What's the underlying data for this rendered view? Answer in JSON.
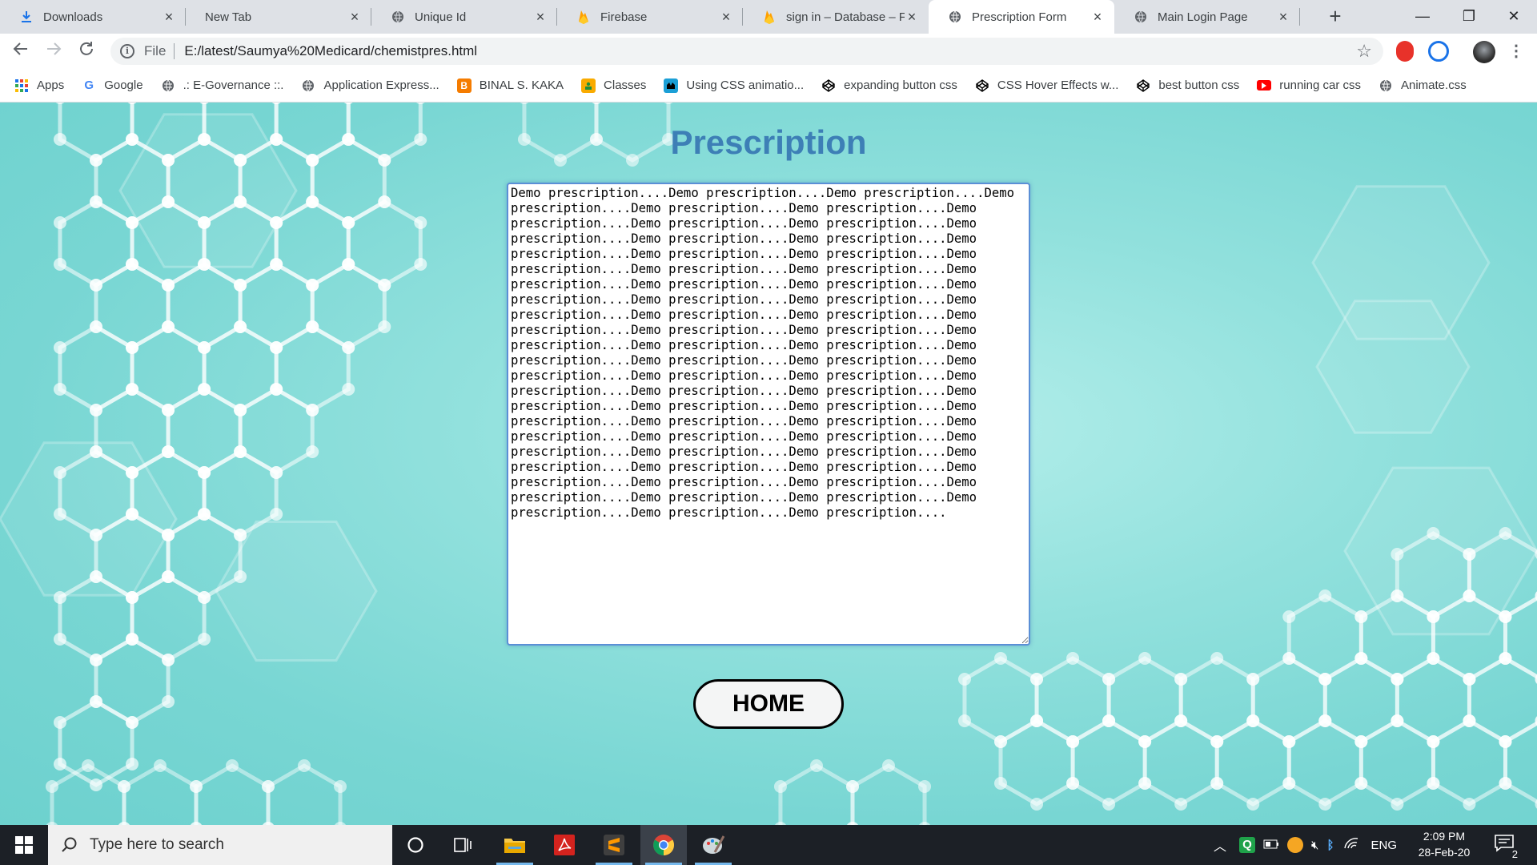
{
  "browser": {
    "tabs": [
      {
        "title": "Downloads",
        "icon": "download-icon",
        "active": false
      },
      {
        "title": "New Tab",
        "icon": "none",
        "active": false
      },
      {
        "title": "Unique Id",
        "icon": "globe-icon",
        "active": false
      },
      {
        "title": "Firebase",
        "icon": "firebase-icon",
        "active": false
      },
      {
        "title": "sign in – Database – Fir",
        "icon": "firebase-icon",
        "active": false
      },
      {
        "title": "Prescription Form",
        "icon": "globe-icon",
        "active": true
      },
      {
        "title": "Main Login Page",
        "icon": "globe-icon",
        "active": false
      }
    ],
    "new_tab_label": "+",
    "window_controls": {
      "minimize": "—",
      "restore": "❐",
      "close": "✕"
    },
    "address": {
      "scheme_label": "File",
      "url": "E:/latest/Saumya%20Medicard/chemistpres.html"
    },
    "bookmarks": [
      {
        "label": "Apps",
        "icon": "apps-grid-icon"
      },
      {
        "label": "Google",
        "icon": "google-icon"
      },
      {
        "label": ".: E-Governance ::.",
        "icon": "globe-icon"
      },
      {
        "label": "Application Express...",
        "icon": "globe-icon"
      },
      {
        "label": "BINAL S. KAKA",
        "icon": "blogger-icon"
      },
      {
        "label": "Classes",
        "icon": "classroom-icon"
      },
      {
        "label": "Using CSS animatio...",
        "icon": "mdn-icon"
      },
      {
        "label": "expanding button css",
        "icon": "codepen-icon"
      },
      {
        "label": "CSS Hover Effects w...",
        "icon": "codepen-icon"
      },
      {
        "label": "best button css",
        "icon": "codepen-icon"
      },
      {
        "label": "running car css",
        "icon": "youtube-icon"
      },
      {
        "label": "Animate.css",
        "icon": "globe-icon"
      }
    ]
  },
  "page": {
    "title": "Prescription",
    "prescription_text": "Demo prescription....Demo prescription....Demo prescription....Demo prescription....Demo prescription....Demo prescription....Demo prescription....Demo prescription....Demo prescription....Demo prescription....Demo prescription....Demo prescription....Demo prescription....Demo prescription....Demo prescription....Demo prescription....Demo prescription....Demo prescription....Demo prescription....Demo prescription....Demo prescription....Demo prescription....Demo prescription....Demo prescription....Demo prescription....Demo prescription....Demo prescription....Demo prescription....Demo prescription....Demo prescription....Demo prescription....Demo prescription....Demo prescription....Demo prescription....Demo prescription....Demo prescription....Demo prescription....Demo prescription....Demo prescription....Demo prescription....Demo prescription....Demo prescription....Demo prescription....Demo prescription....Demo prescription....Demo prescription....Demo prescription....Demo prescription....Demo prescription....Demo prescription....Demo prescription....Demo prescription....Demo prescription....Demo prescription....Demo prescription....Demo prescription....Demo prescription....Demo prescription....Demo prescription....Demo prescription....Demo prescription....Demo prescription....Demo prescription....Demo prescription....Demo prescription....Demo prescription....",
    "home_button": "HOME",
    "colors": {
      "title": "#3d7fb6",
      "background": "#8fe0dc"
    }
  },
  "taskbar": {
    "search_placeholder": "Type here to search",
    "pinned": [
      "cortana-icon",
      "task-view-icon",
      "file-explorer-icon",
      "acrobat-icon",
      "sublime-text-icon",
      "chrome-icon",
      "paint-icon"
    ],
    "tray_language": "ENG",
    "time": "2:09 PM",
    "date": "28-Feb-20",
    "notification_count": "2"
  }
}
